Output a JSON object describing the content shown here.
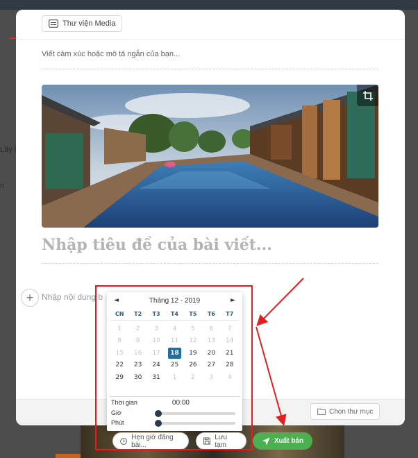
{
  "colors": {
    "accent_blue": "#1d6fa5",
    "publish_green": "#4caf50",
    "annotation_red": "#e41e1e"
  },
  "background": {
    "side_text_1": "Lấy l",
    "side_text_2": "n"
  },
  "modal": {
    "media_library_label": "Thư viện Media",
    "caption_placeholder": "Viết cảm xúc hoặc mô tả ngắn của bạn...",
    "title_placeholder": "Nhập tiêu đề của bài viết...",
    "content_placeholder": "Nhập nội dung b",
    "choose_folder_label": "Chọn thư mục",
    "icons": {
      "media": "folder-outline-icon",
      "crop": "crop-icon",
      "add": "plus-icon",
      "folder": "folder-icon"
    }
  },
  "calendar": {
    "prev_arrow": "◄",
    "next_arrow": "►",
    "month_label": "Tháng 12 - 2019",
    "weekdays": [
      "CN",
      "T2",
      "T3",
      "T4",
      "T5",
      "T6",
      "T7"
    ],
    "days": [
      {
        "d": "1",
        "muted": true
      },
      {
        "d": "2",
        "muted": true
      },
      {
        "d": "3",
        "muted": true
      },
      {
        "d": "4",
        "muted": true
      },
      {
        "d": "5",
        "muted": true
      },
      {
        "d": "6",
        "muted": true
      },
      {
        "d": "7",
        "muted": true
      },
      {
        "d": "8",
        "muted": true
      },
      {
        "d": "9",
        "muted": true
      },
      {
        "d": "10",
        "muted": true
      },
      {
        "d": "11",
        "muted": true
      },
      {
        "d": "12",
        "muted": true
      },
      {
        "d": "13",
        "muted": true
      },
      {
        "d": "14",
        "muted": true
      },
      {
        "d": "15",
        "muted": true
      },
      {
        "d": "16",
        "muted": true
      },
      {
        "d": "17",
        "muted": true
      },
      {
        "d": "18",
        "selected": true
      },
      {
        "d": "19"
      },
      {
        "d": "20"
      },
      {
        "d": "21"
      },
      {
        "d": "22"
      },
      {
        "d": "23"
      },
      {
        "d": "24"
      },
      {
        "d": "25"
      },
      {
        "d": "26"
      },
      {
        "d": "27"
      },
      {
        "d": "28"
      },
      {
        "d": "29"
      },
      {
        "d": "30"
      },
      {
        "d": "31"
      },
      {
        "d": "1",
        "muted": true
      },
      {
        "d": "2",
        "muted": true
      },
      {
        "d": "3",
        "muted": true
      },
      {
        "d": "4",
        "muted": true
      }
    ],
    "time_label": "Thời gian",
    "time_value": "00:00",
    "hour_label": "Giờ",
    "minute_label": "Phút",
    "hour_level": 0,
    "minute_level": 0
  },
  "toolbar": {
    "schedule_placeholder": "Hẹn giờ đăng bài...",
    "save_label": "Lưu tạm",
    "publish_label": "Xuất bản",
    "icons": {
      "schedule": "clock-icon",
      "save": "save-icon",
      "publish": "send-icon"
    }
  }
}
